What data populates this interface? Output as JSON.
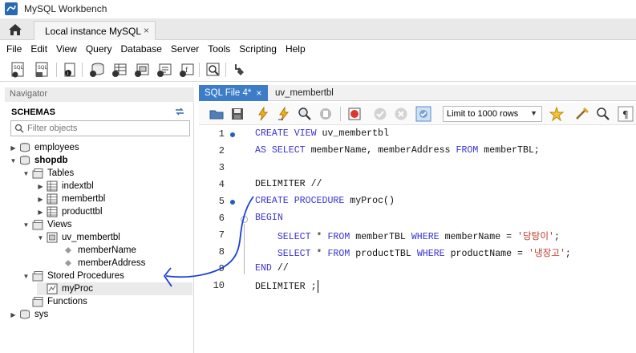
{
  "window": {
    "title": "MySQL Workbench"
  },
  "connection_tab": {
    "label": "Local instance MySQL",
    "close": "×"
  },
  "menu": [
    "File",
    "Edit",
    "View",
    "Query",
    "Database",
    "Server",
    "Tools",
    "Scripting",
    "Help"
  ],
  "navigator": {
    "header": "Navigator",
    "schemas_label": "SCHEMAS",
    "filter_placeholder": "Filter objects",
    "tree": [
      {
        "label": "employees",
        "arrow": "▶",
        "icon": "database-icon",
        "bold": false
      },
      {
        "label": "shopdb",
        "arrow": "▼",
        "icon": "database-icon",
        "bold": true
      },
      {
        "label": "Tables",
        "arrow": "▼",
        "icon": "folder-icon",
        "bold": false
      },
      {
        "label": "indextbl",
        "arrow": "▶",
        "icon": "table-icon",
        "bold": false
      },
      {
        "label": "membertbl",
        "arrow": "▶",
        "icon": "table-icon",
        "bold": false
      },
      {
        "label": "producttbl",
        "arrow": "▶",
        "icon": "table-icon",
        "bold": false
      },
      {
        "label": "Views",
        "arrow": "▼",
        "icon": "folder-icon",
        "bold": false
      },
      {
        "label": "uv_membertbl",
        "arrow": "▼",
        "icon": "view-icon",
        "bold": false
      },
      {
        "label": "memberName",
        "arrow": "",
        "icon": "column-icon",
        "bold": false
      },
      {
        "label": "memberAddress",
        "arrow": "",
        "icon": "column-icon",
        "bold": false
      },
      {
        "label": "Stored Procedures",
        "arrow": "▼",
        "icon": "folder-icon",
        "bold": false
      },
      {
        "label": "myProc",
        "arrow": "",
        "icon": "procedure-icon",
        "bold": false
      },
      {
        "label": "Functions",
        "arrow": "",
        "icon": "folder-icon",
        "bold": false
      },
      {
        "label": "sys",
        "arrow": "▶",
        "icon": "database-icon",
        "bold": false
      }
    ]
  },
  "editor_tabs": [
    {
      "label": "SQL File 4*",
      "close": "×",
      "active": true
    },
    {
      "label": "uv_membertbl",
      "active": false
    }
  ],
  "editor_toolbar": {
    "limit_label": "Limit to 1000 rows"
  },
  "code": {
    "line_numbers": [
      "1",
      "2",
      "3",
      "4",
      "5",
      "6",
      "7",
      "8",
      "9",
      "10"
    ],
    "lines": [
      [
        {
          "t": "CREATE VIEW",
          "c": "kw"
        },
        {
          "t": " uv_membertbl",
          "c": ""
        }
      ],
      [
        {
          "t": "AS SELECT",
          "c": "kw"
        },
        {
          "t": " memberName, memberAddress ",
          "c": ""
        },
        {
          "t": "FROM",
          "c": "kw"
        },
        {
          "t": " memberTBL;",
          "c": ""
        }
      ],
      [],
      [
        {
          "t": "DELIMITER //",
          "c": ""
        }
      ],
      [
        {
          "t": "CREATE PROCEDURE",
          "c": "kw"
        },
        {
          "t": " myProc()",
          "c": ""
        }
      ],
      [
        {
          "t": "BEGIN",
          "c": "kw"
        }
      ],
      [
        {
          "t": "    ",
          "c": ""
        },
        {
          "t": "SELECT",
          "c": "kw"
        },
        {
          "t": " * ",
          "c": ""
        },
        {
          "t": "FROM",
          "c": "kw"
        },
        {
          "t": " memberTBL ",
          "c": ""
        },
        {
          "t": "WHERE",
          "c": "kw"
        },
        {
          "t": " memberName = ",
          "c": ""
        },
        {
          "t": "'당탕이'",
          "c": "str"
        },
        {
          "t": ";",
          "c": ""
        }
      ],
      [
        {
          "t": "    ",
          "c": ""
        },
        {
          "t": "SELECT",
          "c": "kw"
        },
        {
          "t": " * ",
          "c": ""
        },
        {
          "t": "FROM",
          "c": "kw"
        },
        {
          "t": " productTBL ",
          "c": ""
        },
        {
          "t": "WHERE",
          "c": "kw"
        },
        {
          "t": " productName = ",
          "c": ""
        },
        {
          "t": "'냉장고'",
          "c": "str"
        },
        {
          "t": ";",
          "c": ""
        }
      ],
      [
        {
          "t": "END",
          "c": "kw"
        },
        {
          "t": " //",
          "c": ""
        }
      ],
      [
        {
          "t": "DELIMITER ;",
          "c": ""
        }
      ]
    ]
  },
  "colors": {
    "accent": "#3c7cc8",
    "keyword": "#3a33d2",
    "string": "#c0392b",
    "annotation": "#1a3fd8"
  }
}
